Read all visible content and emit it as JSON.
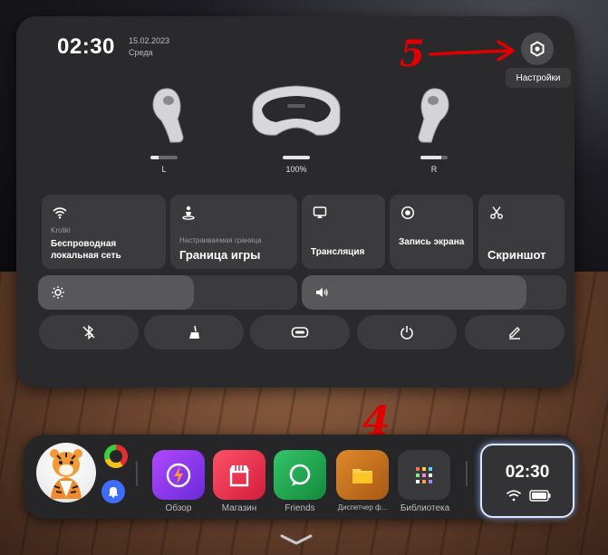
{
  "header": {
    "time": "02:30",
    "date": "15.02.2023",
    "day": "Среда"
  },
  "settings": {
    "tooltip": "Настройки",
    "icon": "hexagon-gear-icon"
  },
  "devices": [
    {
      "name": "left-controller",
      "label": "L",
      "level": 0.3
    },
    {
      "name": "headset",
      "label": "100%",
      "level": 1.0
    },
    {
      "name": "right-controller",
      "label": "R",
      "level": 0.75
    }
  ],
  "tiles": {
    "wifi": {
      "sub": "Kroliki",
      "title": "Беспроводная локальная сеть",
      "icon": "wifi-icon"
    },
    "boundary": {
      "sub": "Настраиваемая граница",
      "title": "Граница игры",
      "icon": "boundary-icon"
    },
    "cast": {
      "title": "Трансляция",
      "icon": "cast-icon"
    },
    "record": {
      "title": "Запись экрана",
      "icon": "record-icon"
    },
    "screenshot": {
      "title": "Скриншот",
      "icon": "scissors-icon"
    }
  },
  "sliders": {
    "brightness": {
      "icon": "brightness-icon",
      "level": 0.6
    },
    "volume": {
      "icon": "volume-icon",
      "level": 0.85
    }
  },
  "quick_buttons": [
    "bluetooth-off-icon",
    "clean-icon",
    "headset-link-icon",
    "power-icon",
    "edit-icon"
  ],
  "annotations": {
    "five": "5",
    "four": "4"
  },
  "taskbar": {
    "apps": [
      {
        "label": "Обзор",
        "icon": "explore-icon",
        "color": "#8a3cf0"
      },
      {
        "label": "Магазин",
        "icon": "store-icon",
        "color": "#e8324a"
      },
      {
        "label": "Friends",
        "icon": "chat-icon",
        "color": "#1f9a4a"
      },
      {
        "label": "Диспетчер ф...",
        "icon": "folder-icon",
        "color": "#c9741c"
      },
      {
        "label": "Библиотека",
        "icon": "grid-icon",
        "color": "#3a3a3d"
      }
    ],
    "clock": {
      "time": "02:30"
    }
  }
}
